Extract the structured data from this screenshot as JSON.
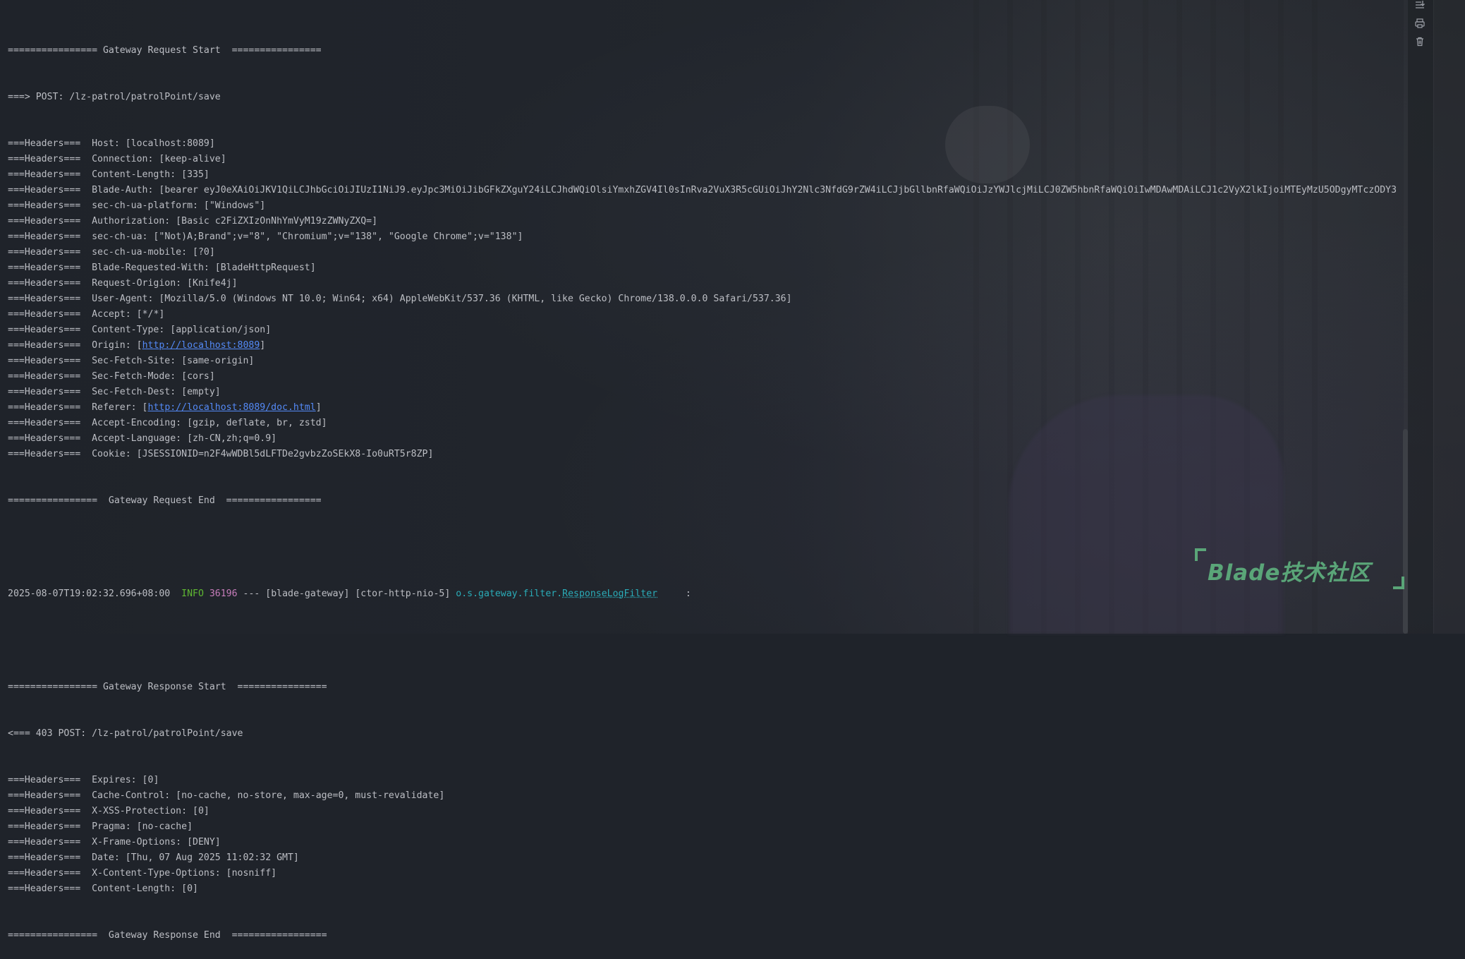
{
  "request": {
    "start_line": "================ Gateway Request Start  ================",
    "method_prefix": "===> POST: /lz-patrol/patrolPoint/save",
    "headers": [
      {
        "prefix": "===Headers===  Host: [",
        "value": "localhost:8089",
        "suffix": "]",
        "is_link": false
      },
      {
        "prefix": "===Headers===  Connection: [",
        "value": "keep-alive",
        "suffix": "]",
        "is_link": false
      },
      {
        "prefix": "===Headers===  Content-Length: [",
        "value": "335",
        "suffix": "]",
        "is_link": false
      },
      {
        "prefix": "===Headers===  Blade-Auth: [",
        "value": "bearer eyJ0eXAiOiJKV1QiLCJhbGciOiJIUzI1NiJ9.eyJpc3MiOiJibGFkZXguY24iLCJhdWQiOlsiYmxhZGV4Il0sInRva2VuX3R5cGUiOiJhY2Nlc3NfdG9rZW4iLCJjbGllbnRfaWQiOiJzYWJlcjMiLCJ0ZW5hbnRfaWQiOiIwMDAwMDAiLCJ1c2VyX2lkIjoiMTEyMzU5ODgyMTczODY3",
        "suffix": "",
        "is_link": false
      },
      {
        "prefix": "===Headers===  sec-ch-ua-platform: [",
        "value": "\"Windows\"",
        "suffix": "]",
        "is_link": false
      },
      {
        "prefix": "===Headers===  Authorization: [",
        "value": "Basic c2FiZXIzOnNhYmVyM19zZWNyZXQ=",
        "suffix": "]",
        "is_link": false
      },
      {
        "prefix": "===Headers===  sec-ch-ua: [",
        "value": "\"Not)A;Brand\";v=\"8\", \"Chromium\";v=\"138\", \"Google Chrome\";v=\"138\"",
        "suffix": "]",
        "is_link": false
      },
      {
        "prefix": "===Headers===  sec-ch-ua-mobile: [",
        "value": "?0",
        "suffix": "]",
        "is_link": false
      },
      {
        "prefix": "===Headers===  Blade-Requested-With: [",
        "value": "BladeHttpRequest",
        "suffix": "]",
        "is_link": false
      },
      {
        "prefix": "===Headers===  Request-Origion: [",
        "value": "Knife4j",
        "suffix": "]",
        "is_link": false
      },
      {
        "prefix": "===Headers===  User-Agent: [",
        "value": "Mozilla/5.0 (Windows NT 10.0; Win64; x64) AppleWebKit/537.36 (KHTML, like Gecko) Chrome/138.0.0.0 Safari/537.36",
        "suffix": "]",
        "is_link": false
      },
      {
        "prefix": "===Headers===  Accept: [",
        "value": "*/*",
        "suffix": "]",
        "is_link": false
      },
      {
        "prefix": "===Headers===  Content-Type: [",
        "value": "application/json",
        "suffix": "]",
        "is_link": false
      },
      {
        "prefix": "===Headers===  Origin: [",
        "value": "http://localhost:8089",
        "suffix": "]",
        "is_link": true
      },
      {
        "prefix": "===Headers===  Sec-Fetch-Site: [",
        "value": "same-origin",
        "suffix": "]",
        "is_link": false
      },
      {
        "prefix": "===Headers===  Sec-Fetch-Mode: [",
        "value": "cors",
        "suffix": "]",
        "is_link": false
      },
      {
        "prefix": "===Headers===  Sec-Fetch-Dest: [",
        "value": "empty",
        "suffix": "]",
        "is_link": false
      },
      {
        "prefix": "===Headers===  Referer: [",
        "value": "http://localhost:8089/doc.html",
        "suffix": "]",
        "is_link": true
      },
      {
        "prefix": "===Headers===  Accept-Encoding: [",
        "value": "gzip, deflate, br, zstd",
        "suffix": "]",
        "is_link": false
      },
      {
        "prefix": "===Headers===  Accept-Language: [",
        "value": "zh-CN,zh;q=0.9",
        "suffix": "]",
        "is_link": false
      },
      {
        "prefix": "===Headers===  Cookie: [",
        "value": "JSESSIONID=n2F4wWDBl5dLFTDe2gvbzZoSEkX8-Io0uRT5r8ZP",
        "suffix": "]",
        "is_link": false
      }
    ],
    "end_line": "================  Gateway Request End  ================="
  },
  "log_entry": {
    "timestamp": "2025-08-07T19:02:32.696+08:00",
    "level": "INFO",
    "pid": "36196",
    "separator": "---",
    "app": "[blade-gateway]",
    "thread": "[ctor-http-nio-5]",
    "logger_pkg": "o.s.gateway.filter.",
    "logger_cls": "ResponseLogFilter",
    "colon": ":"
  },
  "response": {
    "start_line": "================ Gateway Response Start  ================",
    "status_line": "<=== 403 POST: /lz-patrol/patrolPoint/save",
    "headers": [
      {
        "prefix": "===Headers===  Expires: [",
        "value": "0",
        "suffix": "]",
        "is_link": false
      },
      {
        "prefix": "===Headers===  Cache-Control: [",
        "value": "no-cache, no-store, max-age=0, must-revalidate",
        "suffix": "]",
        "is_link": false
      },
      {
        "prefix": "===Headers===  X-XSS-Protection: [",
        "value": "0",
        "suffix": "]",
        "is_link": false
      },
      {
        "prefix": "===Headers===  Pragma: [",
        "value": "no-cache",
        "suffix": "]",
        "is_link": false
      },
      {
        "prefix": "===Headers===  X-Frame-Options: [",
        "value": "DENY",
        "suffix": "]",
        "is_link": false
      },
      {
        "prefix": "===Headers===  Date: [",
        "value": "Thu, 07 Aug 2025 11:02:32 GMT",
        "suffix": "]",
        "is_link": false
      },
      {
        "prefix": "===Headers===  X-Content-Type-Options: [",
        "value": "nosniff",
        "suffix": "]",
        "is_link": false
      },
      {
        "prefix": "===Headers===  Content-Length: [",
        "value": "0",
        "suffix": "]",
        "is_link": false
      }
    ],
    "end_line": "================  Gateway Response End  ================="
  },
  "toolbar": {
    "icons": [
      "scroll-to-end-icon",
      "print-icon",
      "trash-icon"
    ]
  },
  "watermark": {
    "text": "Blade技术社区"
  },
  "colors": {
    "text": "#bcbec4",
    "link": "#548af7",
    "info": "#5fb832",
    "pid": "#c77dbb",
    "logger": "#2aacb8",
    "watermark": "#5aa578"
  }
}
